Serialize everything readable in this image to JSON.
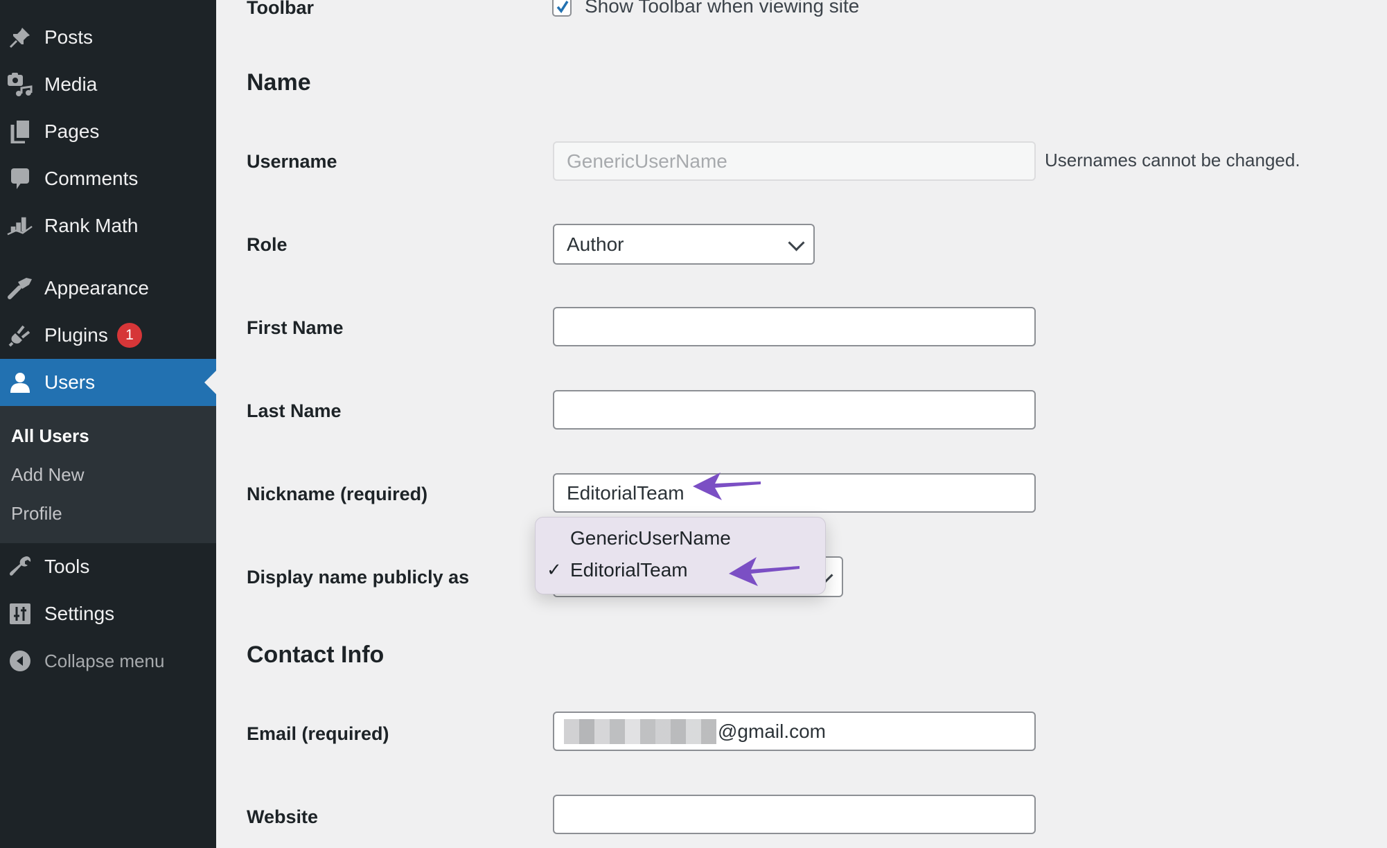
{
  "sidebar": {
    "items": [
      {
        "label": "Posts",
        "icon": "pushpin-icon"
      },
      {
        "label": "Media",
        "icon": "media-icon"
      },
      {
        "label": "Pages",
        "icon": "pages-icon"
      },
      {
        "label": "Comments",
        "icon": "comment-icon"
      },
      {
        "label": "Rank Math",
        "icon": "chart-icon"
      },
      {
        "label": "Appearance",
        "icon": "paintbrush-icon"
      },
      {
        "label": "Plugins",
        "icon": "plug-icon",
        "badge": "1"
      },
      {
        "label": "Users",
        "icon": "user-icon",
        "active": true
      },
      {
        "label": "Tools",
        "icon": "wrench-icon"
      },
      {
        "label": "Settings",
        "icon": "settings-icon"
      }
    ],
    "submenu": [
      {
        "label": "All Users",
        "current": true
      },
      {
        "label": "Add New"
      },
      {
        "label": "Profile"
      }
    ],
    "collapse_label": "Collapse menu"
  },
  "form": {
    "toolbar": {
      "label": "Toolbar",
      "checkbox_label": "Show Toolbar when viewing site",
      "checked": true
    },
    "name_section_title": "Name",
    "username": {
      "label": "Username",
      "value": "GenericUserName",
      "description": "Usernames cannot be changed."
    },
    "role": {
      "label": "Role",
      "value": "Author"
    },
    "first_name": {
      "label": "First Name",
      "value": ""
    },
    "last_name": {
      "label": "Last Name",
      "value": ""
    },
    "nickname": {
      "label": "Nickname (required)",
      "value": "EditorialTeam"
    },
    "display_name": {
      "label": "Display name publicly as",
      "options": [
        "GenericUserName",
        "EditorialTeam"
      ],
      "selected": "EditorialTeam",
      "check_glyph": "✓"
    },
    "contact_section_title": "Contact Info",
    "email": {
      "label": "Email (required)",
      "value_visible_suffix": "@gmail.com"
    },
    "website": {
      "label": "Website",
      "value": ""
    }
  },
  "colors": {
    "sidebar_bg": "#1d2327",
    "active_bg": "#2271b1",
    "badge": "#d63638",
    "annotation_arrow": "#7b4fc4"
  }
}
